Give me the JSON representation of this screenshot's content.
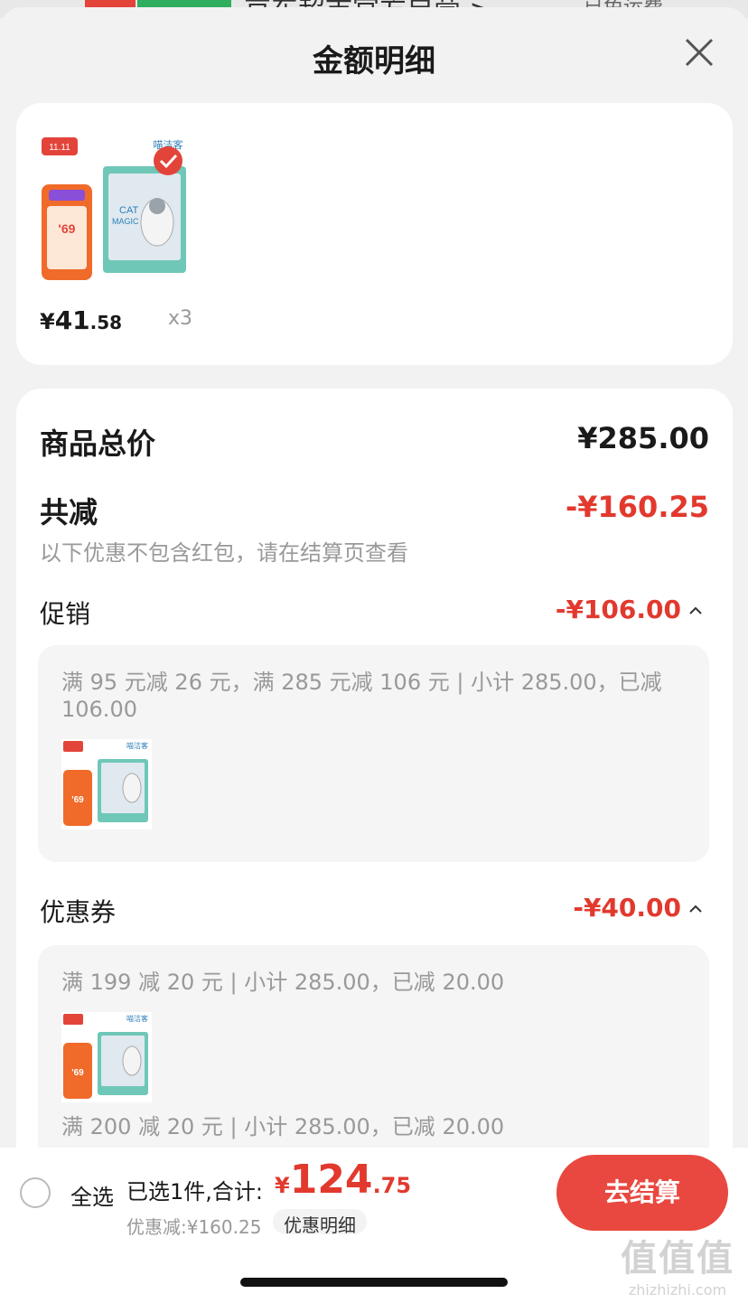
{
  "background": {
    "badge_text": "自营",
    "badge2_text": "京东超市",
    "store_text": "京东超市官方自营 >",
    "right_text": "已免运费"
  },
  "header": {
    "title": "金额明细",
    "close_icon": "close-icon"
  },
  "product": {
    "price_currency": "¥",
    "price_integer": "41",
    "price_decimal": ".58",
    "quantity": "x3",
    "image_icon": "cat-litter-product-image",
    "brand_text": "CAT MAGIC",
    "promo_price": "'69"
  },
  "summary": {
    "total_label": "商品总价",
    "total_value": "¥285.00",
    "reduce_label": "共减",
    "reduce_value": "-¥160.25",
    "note": "以下优惠不包含红包，请在结算页查看"
  },
  "promotion": {
    "label": "促销",
    "value": "-¥106.00",
    "detail": "满 95 元减 26 元，满 285 元减 106 元 | 小计 285.00，已减 106.00"
  },
  "coupon": {
    "label": "优惠券",
    "value": "-¥40.00",
    "detail_1": "满 199 减 20 元 | 小计 285.00，已减 20.00",
    "detail_2": "满 200 减 20 元 | 小计 285.00，已减 20.00"
  },
  "bottom_bar": {
    "select_all": "全选",
    "selected_label": "已选1件,合计:",
    "total_currency": "¥",
    "total_integer": "124",
    "total_decimal": ".75",
    "discount_note": "优惠减:¥160.25",
    "detail_chip": "优惠明细",
    "checkout": "去结算"
  },
  "watermark": {
    "big": "值值值",
    "small": "zhizhizhi.com"
  },
  "colors": {
    "accent_red": "#e2392e",
    "button_red": "#e8483f",
    "panel_bg": "#f5f5f5"
  }
}
